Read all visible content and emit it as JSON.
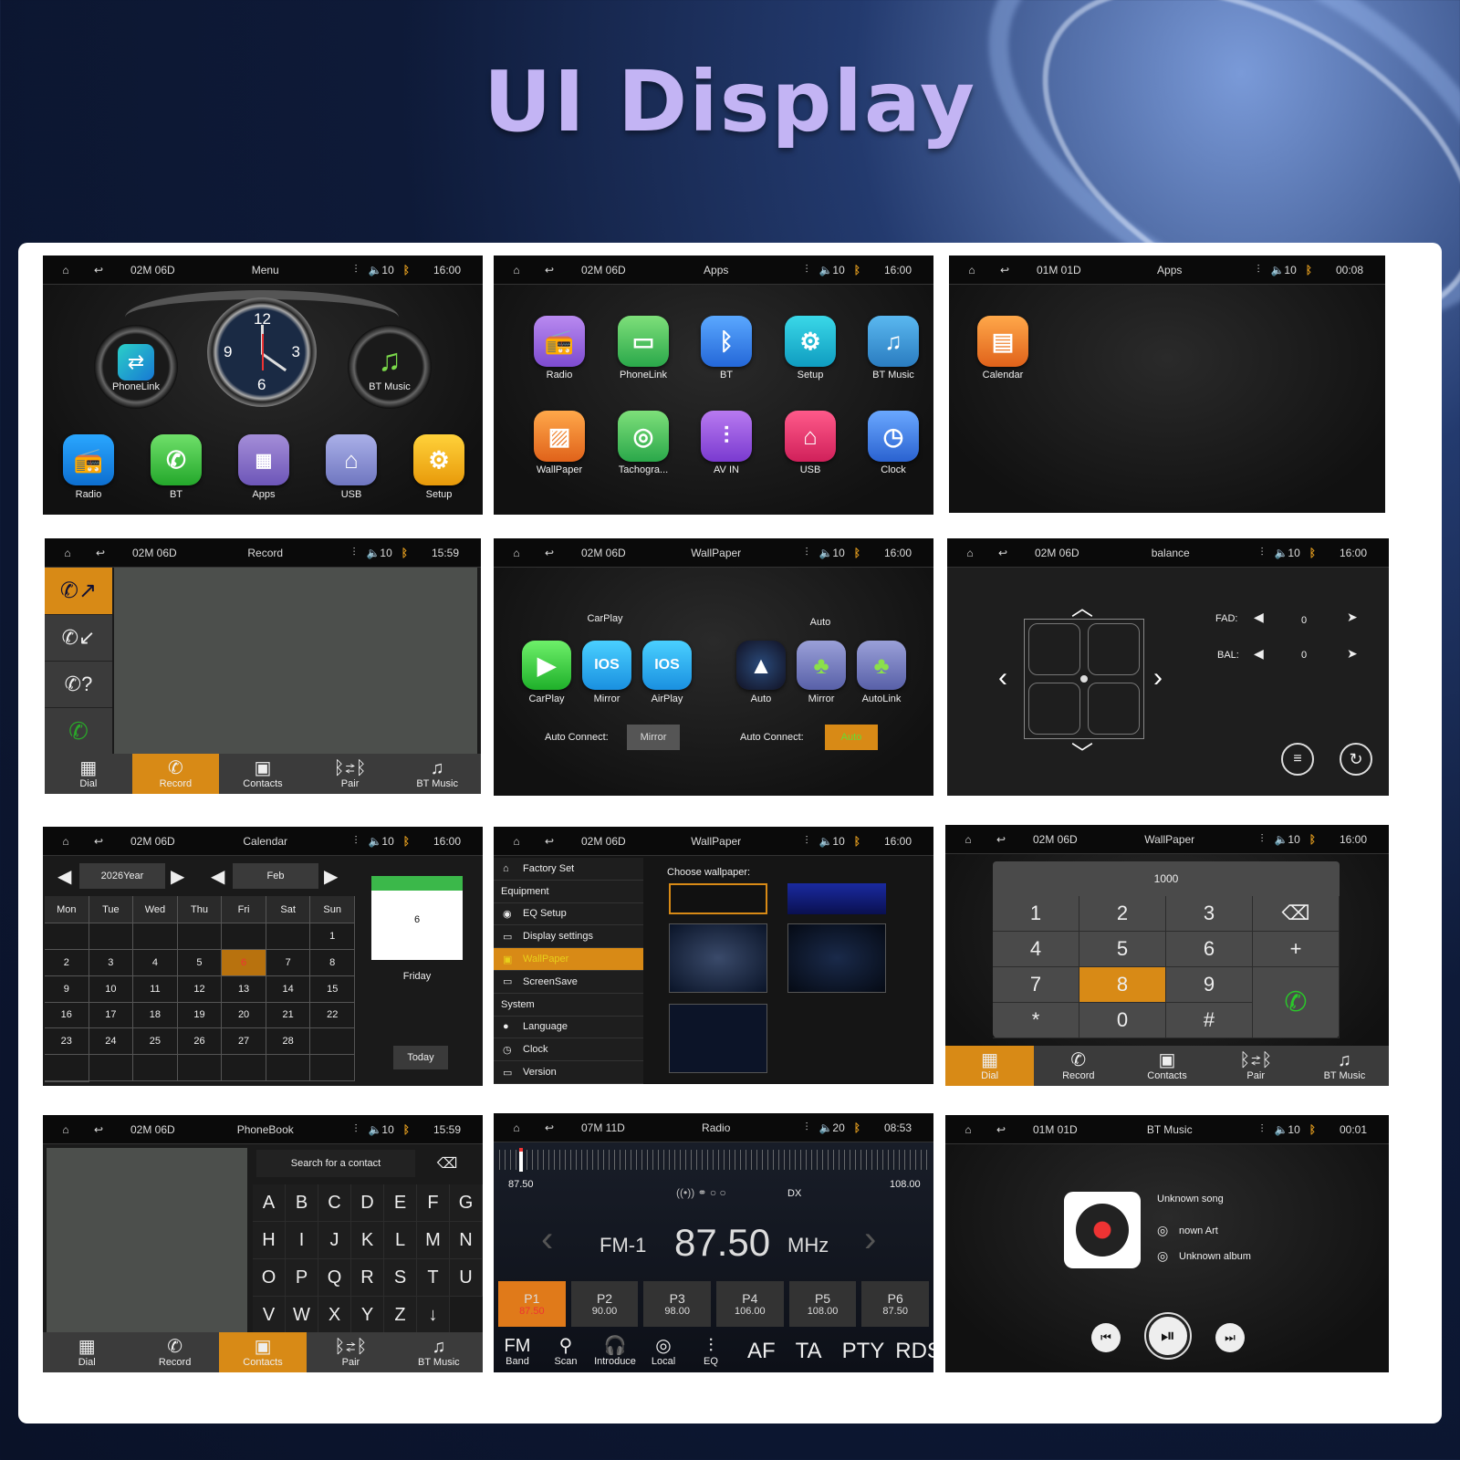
{
  "headline": "UI Display",
  "colors": {
    "accent": "#d88a16",
    "bt": "#e09b1e",
    "title": "#c3b4f4"
  },
  "statusbar_icons": [
    "home-icon",
    "back-icon",
    "eq-icon",
    "volume-icon",
    "bluetooth-icon"
  ],
  "s1": {
    "date": "02M 06D",
    "title": "Menu",
    "vol": "10",
    "time": "16:00",
    "clock": {
      "n12": "12",
      "n3": "3",
      "n6": "6",
      "n9": "9"
    },
    "gauges": [
      "PhoneLink",
      "BT Music"
    ],
    "apps": [
      "Radio",
      "BT",
      "Apps",
      "USB",
      "Setup"
    ]
  },
  "s2": {
    "date": "02M 06D",
    "title": "Apps",
    "vol": "10",
    "time": "16:00",
    "apps": [
      "Radio",
      "PhoneLink",
      "BT",
      "Setup",
      "BT Music",
      "WallPaper",
      "Tachogra...",
      "AV IN",
      "USB",
      "Clock"
    ]
  },
  "s3": {
    "date": "01M 01D",
    "title": "Apps",
    "vol": "10",
    "time": "00:08",
    "apps": [
      "Calendar"
    ]
  },
  "s4": {
    "date": "02M 06D",
    "title": "Record",
    "vol": "10",
    "time": "15:59",
    "tabs": [
      "Dial",
      "Record",
      "Contacts",
      "Pair",
      "BT Music"
    ]
  },
  "s5": {
    "date": "02M 06D",
    "title": "WallPaper",
    "vol": "10",
    "time": "16:00",
    "carplay_title": "CarPlay",
    "auto_title": "Auto",
    "ios_text": "IOS",
    "left_apps": [
      "CarPlay",
      "Mirror",
      "AirPlay"
    ],
    "right_apps": [
      "Auto",
      "Mirror",
      "AutoLink"
    ],
    "auto_connect": "Auto Connect:",
    "left_btn": "Mirror",
    "right_btn": "Auto"
  },
  "s6": {
    "date": "02M 06D",
    "title": "balance",
    "vol": "10",
    "time": "16:00",
    "fad_label": "FAD:",
    "fad_value": "0",
    "bal_label": "BAL:",
    "bal_value": "0"
  },
  "s7": {
    "date": "02M 06D",
    "title": "Calendar",
    "vol": "10",
    "time": "16:00",
    "year": "2026Year",
    "month": "Feb",
    "weekdays": [
      "Mon",
      "Tue",
      "Wed",
      "Thu",
      "Fri",
      "Sat",
      "Sun"
    ],
    "days": [
      "",
      "",
      "",
      "",
      "",
      "",
      "1",
      "2",
      "3",
      "4",
      "5",
      "6",
      "7",
      "8",
      "9",
      "10",
      "11",
      "12",
      "13",
      "14",
      "15",
      "16",
      "17",
      "18",
      "19",
      "20",
      "21",
      "22",
      "23",
      "24",
      "25",
      "26",
      "27",
      "28",
      "",
      "",
      "",
      "",
      "",
      "",
      "",
      "",
      ""
    ],
    "today_day": "6",
    "today_weekday": "Friday",
    "today_btn": "Today"
  },
  "s8": {
    "date": "02M 06D",
    "title": "WallPaper",
    "vol": "10",
    "time": "16:00",
    "choose": "Choose wallpaper:",
    "menu": [
      {
        "t": "Factory Set",
        "i": "⌂",
        "h": false
      },
      {
        "t": "Equipment",
        "i": "",
        "h": false,
        "sec": true
      },
      {
        "t": "EQ Setup",
        "i": "◉",
        "h": false
      },
      {
        "t": "Display settings",
        "i": "▭",
        "h": false
      },
      {
        "t": "WallPaper",
        "i": "▣",
        "h": true
      },
      {
        "t": "ScreenSave",
        "i": "▭",
        "h": false
      },
      {
        "t": "System",
        "i": "",
        "h": false,
        "sec": true
      },
      {
        "t": "Language",
        "i": "●",
        "h": false
      },
      {
        "t": "Clock",
        "i": "◷",
        "h": false
      },
      {
        "t": "Version",
        "i": "▭",
        "h": false
      }
    ]
  },
  "s9": {
    "date": "02M 06D",
    "title": "WallPaper",
    "vol": "10",
    "time": "16:00",
    "entry": "1000",
    "keys": [
      "1",
      "2",
      "3",
      "⌫",
      "4",
      "5",
      "6",
      "+",
      "7",
      "8",
      "9",
      "",
      "*",
      "0",
      "#",
      ""
    ],
    "tabs": [
      "Dial",
      "Record",
      "Contacts",
      "Pair",
      "BT Music"
    ]
  },
  "s10": {
    "date": "02M 06D",
    "title": "PhoneBook",
    "vol": "10",
    "time": "15:59",
    "search": "Search for a contact",
    "letters": [
      "A",
      "B",
      "C",
      "D",
      "E",
      "F",
      "G",
      "H",
      "I",
      "J",
      "K",
      "L",
      "M",
      "N",
      "O",
      "P",
      "Q",
      "R",
      "S",
      "T",
      "U",
      "V",
      "W",
      "X",
      "Y",
      "Z",
      "↓"
    ],
    "tabs": [
      "Dial",
      "Record",
      "Contacts",
      "Pair",
      "BT Music"
    ]
  },
  "s11": {
    "date": "07M 11D",
    "title": "Radio",
    "vol": "20",
    "time": "08:53",
    "min": "87.50",
    "max": "108.00",
    "dx": "DX",
    "band": "FM-1",
    "freq": "87.50",
    "unit": "MHz",
    "presets": [
      {
        "p": "P1",
        "f": "87.50"
      },
      {
        "p": "P2",
        "f": "90.00"
      },
      {
        "p": "P3",
        "f": "98.00"
      },
      {
        "p": "P4",
        "f": "106.00"
      },
      {
        "p": "P5",
        "f": "108.00"
      },
      {
        "p": "P6",
        "f": "87.50"
      }
    ],
    "bottom": [
      "Band",
      "Scan",
      "Introduce",
      "Local",
      "EQ"
    ],
    "toggles": [
      "AF",
      "TA",
      "PTY",
      "RDS"
    ]
  },
  "s12": {
    "date": "01M 01D",
    "title": "BT Music",
    "vol": "10",
    "time": "00:01",
    "song": "Unknown song",
    "artist": "nown Art",
    "album": "Unknown album"
  }
}
